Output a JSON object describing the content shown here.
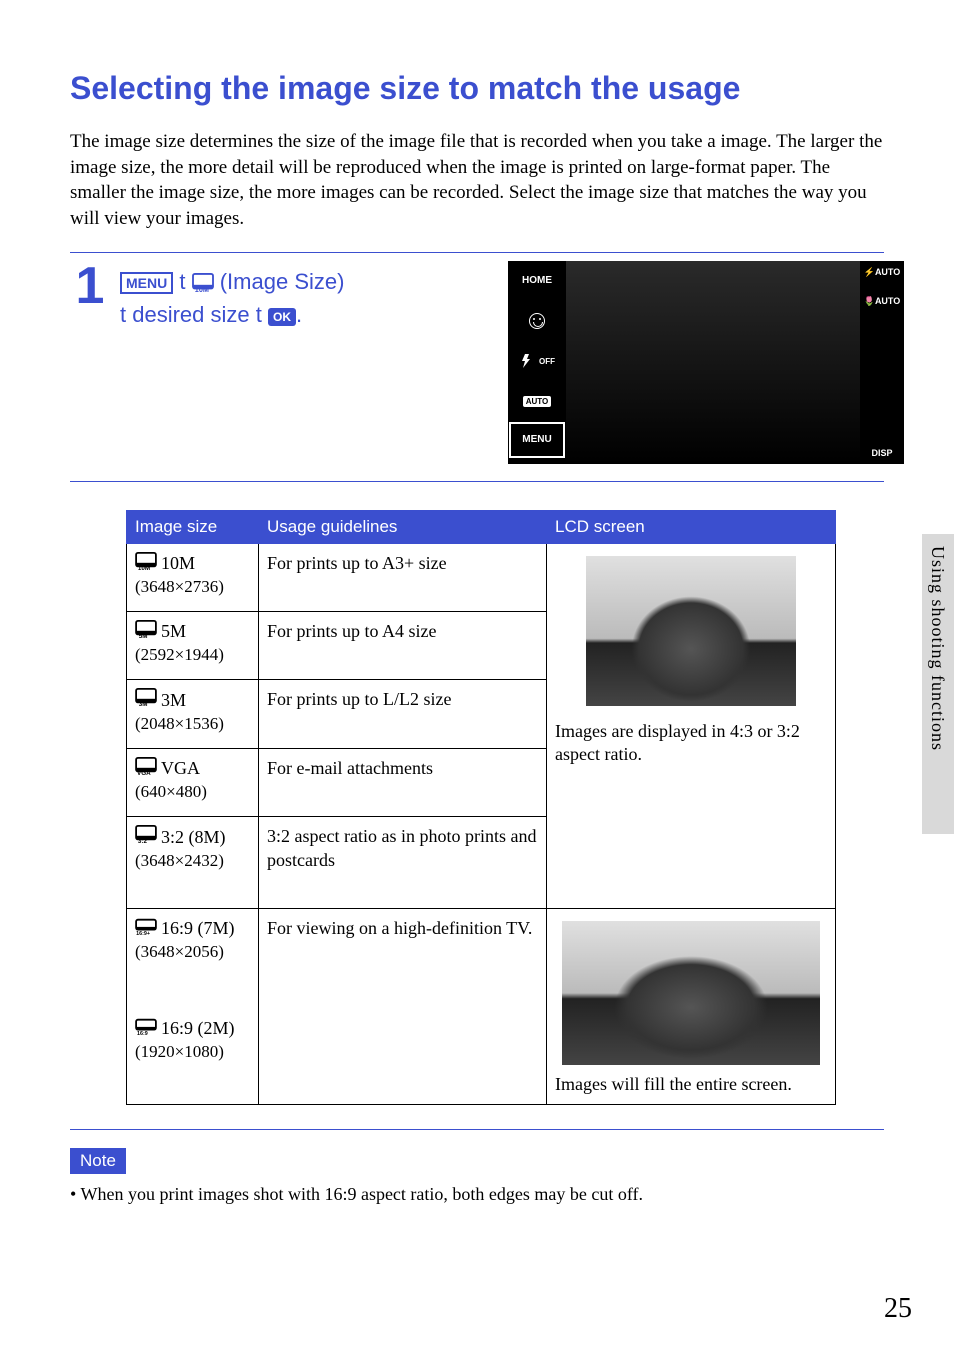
{
  "title": "Selecting the image size to match the usage",
  "intro": "The image size determines the size of the image file that is recorded when you take a image.\nThe larger the image size, the more detail will be reproduced when the image is printed on large-format paper. The smaller the image size, the more images can be recorded. Select the image size that matches the way you will view your images.",
  "step": {
    "num": "1",
    "menu_badge": "MENU",
    "arrow": "t",
    "label": "(Image Size)",
    "line2a": "desired size",
    "ok_badge": "OK",
    "period": "."
  },
  "lcd": {
    "home": "HOME",
    "off": "OFF",
    "auto_small": "AUTO",
    "menu": "MENU",
    "flash_auto": "AUTO",
    "macro_auto": "AUTO",
    "disp": "DISP"
  },
  "table": {
    "headers": {
      "size": "Image size",
      "guide": "Usage guidelines",
      "lcd": "LCD screen"
    },
    "rows": [
      {
        "icon": "10M",
        "label": "10M",
        "res": "(3648×2736)",
        "guide": "For prints up to A3+ size"
      },
      {
        "icon": "5M",
        "label": "5M",
        "res": "(2592×1944)",
        "guide": "For prints up to A4 size"
      },
      {
        "icon": "3M",
        "label": "3M",
        "res": "(2048×1536)",
        "guide": "For prints up to L/L2 size"
      },
      {
        "icon": "VGA",
        "label": "VGA",
        "res": "(640×480)",
        "guide": "For e-mail attachments"
      },
      {
        "icon": "3:2",
        "label": "3:2 (8M)",
        "res": "(3648×2432)",
        "guide": "3:2 aspect ratio as in photo prints and postcards"
      },
      {
        "icon": "16:9+",
        "label": "16:9 (7M)",
        "res": "(3648×2056)",
        "guide": "For viewing on a high-definition TV."
      },
      {
        "icon": "16:9",
        "label": "16:9 (2M)",
        "res": "(1920×1080)",
        "guide": ""
      }
    ],
    "lcd_caption_43": "Images are displayed in 4:3 or 3:2 aspect ratio.",
    "lcd_caption_169": "Images will fill the entire screen."
  },
  "note": {
    "heading": "Note",
    "items": [
      "When you print images shot with 16:9 aspect ratio, both edges may be cut off."
    ]
  },
  "side_label": "Using shooting functions",
  "page_number": "25"
}
